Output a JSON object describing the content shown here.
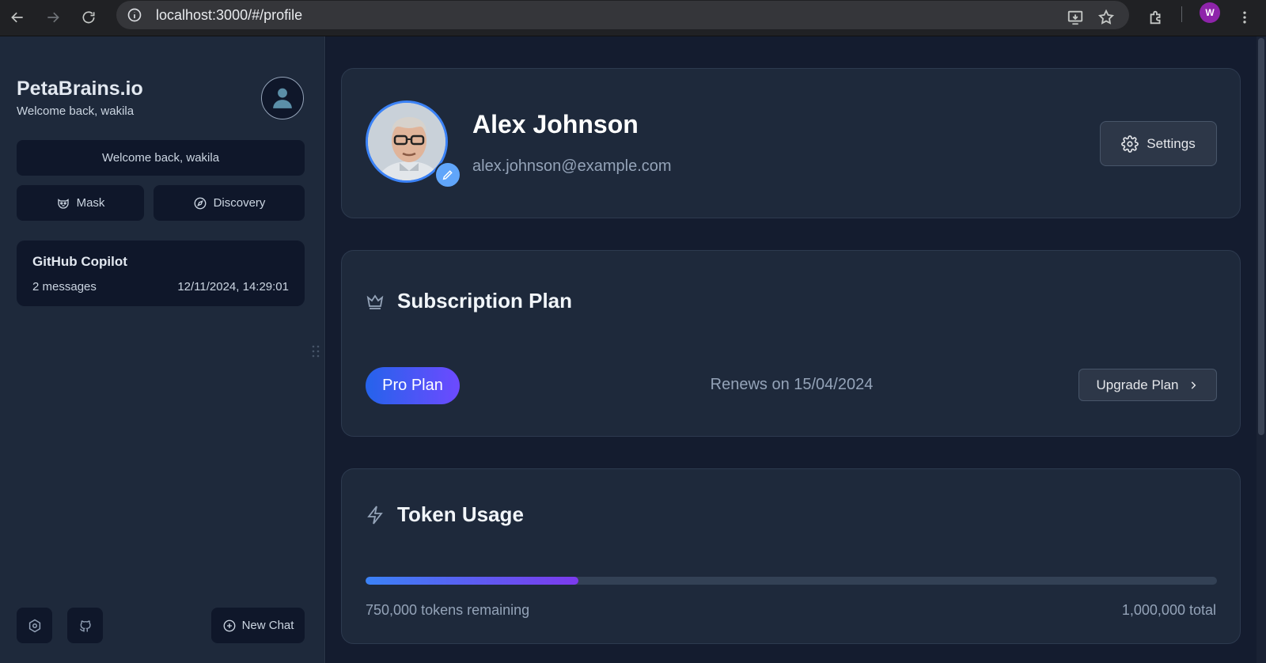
{
  "browser": {
    "url": "localhost:3000/#/profile",
    "profile_initial": "W"
  },
  "sidebar": {
    "brand": "PetaBrains.io",
    "brand_sub": "Welcome back, wakila",
    "welcome": "Welcome back, wakila",
    "mask_label": "Mask",
    "discovery_label": "Discovery",
    "chats": [
      {
        "title": "GitHub Copilot",
        "count": "2 messages",
        "date": "12/11/2024, 14:29:01"
      }
    ],
    "new_chat_label": "New Chat"
  },
  "profile": {
    "name": "Alex Johnson",
    "email": "alex.johnson@example.com",
    "settings_label": "Settings"
  },
  "subscription": {
    "title": "Subscription Plan",
    "plan": "Pro Plan",
    "renews": "Renews on 15/04/2024",
    "upgrade_label": "Upgrade Plan"
  },
  "tokens": {
    "title": "Token Usage",
    "remaining": "750,000 tokens remaining",
    "total": "1,000,000 total",
    "usage_fraction": 0.25
  },
  "colors": {
    "accent": "#3b82f6",
    "accent_purple": "#7c3aed",
    "sidebar_bg": "#1e293b",
    "main_bg": "#141c2f"
  }
}
